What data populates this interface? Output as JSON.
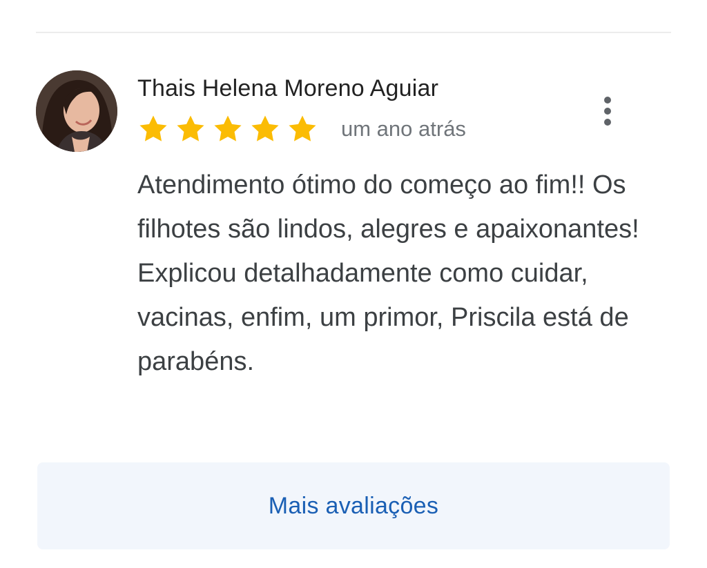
{
  "review": {
    "author": "Thais Helena Moreno Aguiar",
    "rating": 5,
    "rating_max": 5,
    "date": "um ano atrás",
    "text": "Atendimento ótimo do começo ao fim!! Os filhotes são lindos, alegres e apaixonantes! Explicou detalhadamente como cuidar, vacinas, enfim, um primor, Priscila está de parabéns.",
    "menu_icon": "more-vert-icon",
    "star_icon": "star-icon"
  },
  "footer": {
    "more_reviews_label": "Mais avaliações"
  },
  "colors": {
    "star": "#fbbc04",
    "link": "#1a5fb4",
    "button_bg": "#f2f6fc",
    "secondary_text": "#70757a"
  }
}
